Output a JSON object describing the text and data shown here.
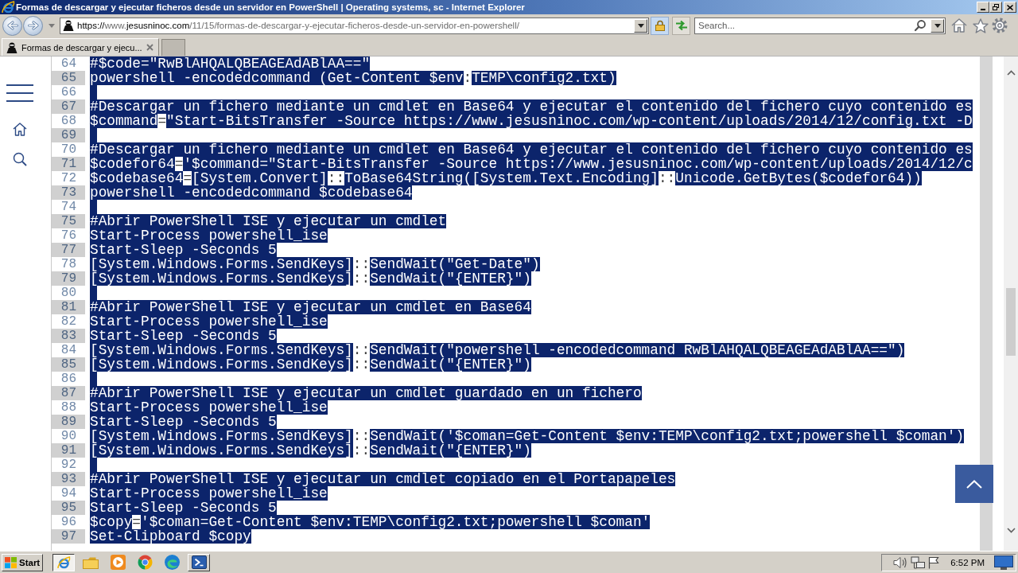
{
  "window": {
    "title": "Formas de descargar y ejecutar ficheros desde un servidor en PowerShell | Operating systems, sc - Internet Explorer"
  },
  "address_bar": {
    "url": [
      {
        "text": "https://",
        "emphasis": true
      },
      {
        "text": "www.",
        "emphasis": false
      },
      {
        "text": "jesusninoc.com",
        "emphasis": true
      },
      {
        "text": "/11/15/formas-de-descargar-y-ejecutar-ficheros-desde-un-servidor-en-powershell/",
        "emphasis": false
      }
    ]
  },
  "search": {
    "placeholder": "Search..."
  },
  "tabs": [
    {
      "label": "Formas de descargar y ejecu...",
      "selected": true
    }
  ],
  "code": {
    "lines": [
      {
        "number": "64",
        "kind": "code",
        "segments": [
          {
            "text": "#$code=\"RwBlAHQALQBEAGEAdABlAA==\"",
            "selected": true
          }
        ]
      },
      {
        "number": "65",
        "kind": "code",
        "segments": [
          {
            "text": "powershell -encodedcommand (Get-Content $env",
            "selected": true
          },
          {
            "text": ":",
            "selected": false
          },
          {
            "text": "TEMP\\config2.txt)",
            "selected": true
          }
        ]
      },
      {
        "number": "66",
        "kind": "blank",
        "selected": true
      },
      {
        "number": "67",
        "kind": "code",
        "segments": [
          {
            "text": "#Descargar un fichero mediante un cmdlet en Base64 y ejecutar el contenido del fichero cuyo contenido es",
            "selected": true
          }
        ]
      },
      {
        "number": "68",
        "kind": "code",
        "segments": [
          {
            "text": "$command",
            "selected": true
          },
          {
            "text": "=",
            "selected": false
          },
          {
            "text": "\"Start-BitsTransfer -Source https://www.jesusninoc.com/wp-content/uploads/2014/12/config.txt -D",
            "selected": true
          }
        ]
      },
      {
        "number": "69",
        "kind": "blank",
        "selected": true
      },
      {
        "number": "70",
        "kind": "code",
        "segments": [
          {
            "text": "#Descargar un fichero mediante un cmdlet en Base64 y ejecutar el contenido del fichero cuyo contenido es",
            "selected": true
          }
        ]
      },
      {
        "number": "71",
        "kind": "code",
        "segments": [
          {
            "text": "$codefor64",
            "selected": true
          },
          {
            "text": "=",
            "selected": false
          },
          {
            "text": "'$command=\"Start-BitsTransfer -Source https://www.jesusninoc.com/wp-content/uploads/2014/12/c",
            "selected": true
          }
        ]
      },
      {
        "number": "72",
        "kind": "code",
        "segments": [
          {
            "text": "$codebase64",
            "selected": true
          },
          {
            "text": "=",
            "selected": false
          },
          {
            "text": "[System.Convert]",
            "selected": true
          },
          {
            "text": "::",
            "selected": false
          },
          {
            "text": "ToBase64String([System.Text.Encoding]",
            "selected": true
          },
          {
            "text": "::",
            "selected": false
          },
          {
            "text": "Unicode.GetBytes($codefor64))",
            "selected": true
          }
        ]
      },
      {
        "number": "73",
        "kind": "code",
        "segments": [
          {
            "text": "powershell -encodedcommand $codebase64",
            "selected": true
          }
        ]
      },
      {
        "number": "74",
        "kind": "blank",
        "selected": true
      },
      {
        "number": "75",
        "kind": "code",
        "segments": [
          {
            "text": "#Abrir PowerShell ISE y ejecutar un cmdlet",
            "selected": true
          }
        ]
      },
      {
        "number": "76",
        "kind": "code",
        "segments": [
          {
            "text": "Start-Process powershell_ise",
            "selected": true
          }
        ]
      },
      {
        "number": "77",
        "kind": "code",
        "segments": [
          {
            "text": "Start-Sleep -Seconds 5",
            "selected": true
          }
        ]
      },
      {
        "number": "78",
        "kind": "code",
        "segments": [
          {
            "text": "[System.Windows.Forms.SendKeys]",
            "selected": true
          },
          {
            "text": "::",
            "selected": false
          },
          {
            "text": "SendWait(\"Get-Date\")",
            "selected": true
          }
        ]
      },
      {
        "number": "79",
        "kind": "code",
        "segments": [
          {
            "text": "[System.Windows.Forms.SendKeys]",
            "selected": true
          },
          {
            "text": "::",
            "selected": false
          },
          {
            "text": "SendWait(\"{ENTER}\")",
            "selected": true
          }
        ]
      },
      {
        "number": "80",
        "kind": "blank",
        "selected": true
      },
      {
        "number": "81",
        "kind": "code",
        "segments": [
          {
            "text": "#Abrir PowerShell ISE y ejecutar un cmdlet en Base64",
            "selected": true
          }
        ]
      },
      {
        "number": "82",
        "kind": "code",
        "segments": [
          {
            "text": "Start-Process powershell_ise",
            "selected": true
          }
        ]
      },
      {
        "number": "83",
        "kind": "code",
        "segments": [
          {
            "text": "Start-Sleep -Seconds 5",
            "selected": true
          }
        ]
      },
      {
        "number": "84",
        "kind": "code",
        "segments": [
          {
            "text": "[System.Windows.Forms.SendKeys]",
            "selected": true
          },
          {
            "text": "::",
            "selected": false
          },
          {
            "text": "SendWait(\"powershell -encodedcommand RwBlAHQALQBEAGEAdABlAA==\")",
            "selected": true
          }
        ]
      },
      {
        "number": "85",
        "kind": "code",
        "segments": [
          {
            "text": "[System.Windows.Forms.SendKeys]",
            "selected": true
          },
          {
            "text": "::",
            "selected": false
          },
          {
            "text": "SendWait(\"{ENTER}\")",
            "selected": true
          }
        ]
      },
      {
        "number": "86",
        "kind": "blank",
        "selected": true
      },
      {
        "number": "87",
        "kind": "code",
        "segments": [
          {
            "text": "#Abrir PowerShell ISE y ejecutar un cmdlet guardado en un fichero",
            "selected": true
          }
        ]
      },
      {
        "number": "88",
        "kind": "code",
        "segments": [
          {
            "text": "Start-Process powershell_ise",
            "selected": true
          }
        ]
      },
      {
        "number": "89",
        "kind": "code",
        "segments": [
          {
            "text": "Start-Sleep -Seconds 5",
            "selected": true
          }
        ]
      },
      {
        "number": "90",
        "kind": "code",
        "segments": [
          {
            "text": "[System.Windows.Forms.SendKeys]",
            "selected": true
          },
          {
            "text": "::",
            "selected": false
          },
          {
            "text": "SendWait('$coman=Get-Content $env:TEMP\\config2.txt;powershell $coman')",
            "selected": true
          }
        ]
      },
      {
        "number": "91",
        "kind": "code",
        "segments": [
          {
            "text": "[System.Windows.Forms.SendKeys]",
            "selected": true
          },
          {
            "text": "::",
            "selected": false
          },
          {
            "text": "SendWait(\"{ENTER}\")",
            "selected": true
          }
        ]
      },
      {
        "number": "92",
        "kind": "blank",
        "selected": true
      },
      {
        "number": "93",
        "kind": "code",
        "segments": [
          {
            "text": "#Abrir PowerShell ISE y ejecutar un cmdlet copiado en el Portapapeles",
            "selected": true
          }
        ]
      },
      {
        "number": "94",
        "kind": "code",
        "segments": [
          {
            "text": "Start-Process powershell_ise",
            "selected": true
          }
        ]
      },
      {
        "number": "95",
        "kind": "code",
        "segments": [
          {
            "text": "Start-Sleep -Seconds 5",
            "selected": true
          }
        ]
      },
      {
        "number": "96",
        "kind": "code",
        "segments": [
          {
            "text": "$copy",
            "selected": true
          },
          {
            "text": "=",
            "selected": false
          },
          {
            "text": "'$coman=Get-Content $env:TEMP\\config2.txt;powershell $coman'",
            "selected": true
          }
        ]
      },
      {
        "number": "97",
        "kind": "code",
        "segments": [
          {
            "text": "Set-Clipboard $copy",
            "selected": true
          }
        ]
      }
    ]
  },
  "taskbar": {
    "start": "Start",
    "items": [
      {
        "open": true,
        "selected": true
      },
      {
        "open": false,
        "selected": false
      },
      {
        "open": false,
        "selected": false
      },
      {
        "open": false,
        "selected": false
      },
      {
        "open": false,
        "selected": false
      },
      {
        "open": true,
        "selected": false
      }
    ],
    "clock": "6:52 PM"
  }
}
